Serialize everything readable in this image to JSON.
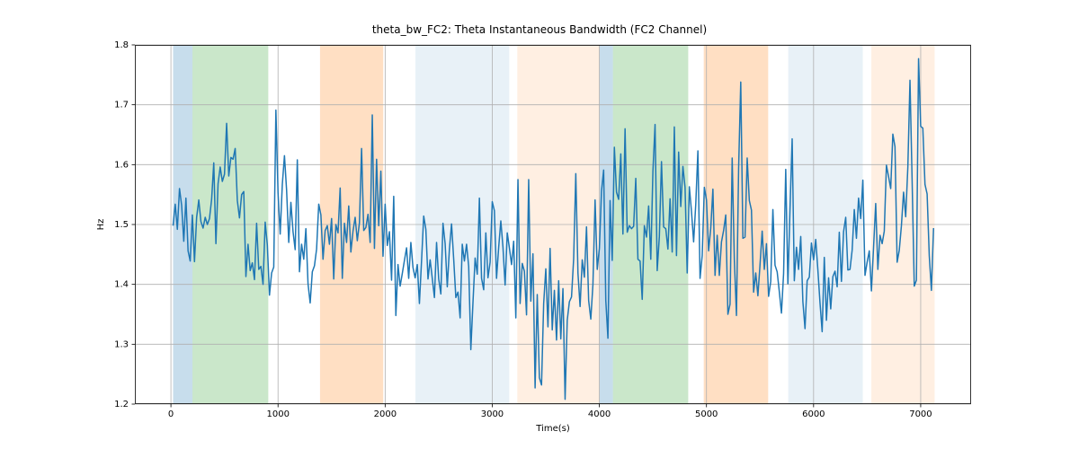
{
  "chart_data": {
    "type": "line",
    "title": "theta_bw_FC2: Theta Instantaneous Bandwidth (FC2 Channel)",
    "xlabel": "Time(s)",
    "ylabel": "Hz",
    "xlim": [
      -336.6,
      7470.6
    ],
    "ylim": [
      1.2,
      1.8
    ],
    "xticks": [
      0,
      1000,
      2000,
      3000,
      4000,
      5000,
      6000,
      7000
    ],
    "yticks": [
      1.2,
      1.3,
      1.4,
      1.5,
      1.6,
      1.7,
      1.8
    ],
    "line_color": "#1f77b4",
    "series": [
      {
        "name": "theta_bw_FC2",
        "x_start": 20,
        "x_step": 20,
        "values": [
          1.498,
          1.534,
          1.492,
          1.56,
          1.532,
          1.472,
          1.544,
          1.456,
          1.439,
          1.516,
          1.438,
          1.512,
          1.541,
          1.505,
          1.494,
          1.512,
          1.5,
          1.51,
          1.542,
          1.603,
          1.468,
          1.568,
          1.596,
          1.572,
          1.584,
          1.669,
          1.581,
          1.612,
          1.609,
          1.627,
          1.54,
          1.511,
          1.55,
          1.555,
          1.413,
          1.467,
          1.423,
          1.436,
          1.408,
          1.502,
          1.425,
          1.43,
          1.4,
          1.504,
          1.466,
          1.382,
          1.419,
          1.429,
          1.691,
          1.553,
          1.484,
          1.567,
          1.615,
          1.557,
          1.47,
          1.537,
          1.488,
          1.458,
          1.608,
          1.421,
          1.467,
          1.442,
          1.493,
          1.401,
          1.369,
          1.421,
          1.431,
          1.459,
          1.534,
          1.516,
          1.442,
          1.49,
          1.498,
          1.467,
          1.51,
          1.409,
          1.5,
          1.486,
          1.561,
          1.41,
          1.502,
          1.47,
          1.531,
          1.454,
          1.489,
          1.512,
          1.473,
          1.503,
          1.627,
          1.49,
          1.495,
          1.517,
          1.47,
          1.683,
          1.46,
          1.609,
          1.498,
          1.589,
          1.447,
          1.534,
          1.465,
          1.488,
          1.407,
          1.547,
          1.348,
          1.433,
          1.397,
          1.418,
          1.44,
          1.461,
          1.41,
          1.47,
          1.428,
          1.411,
          1.433,
          1.368,
          1.44,
          1.514,
          1.492,
          1.409,
          1.441,
          1.41,
          1.378,
          1.47,
          1.409,
          1.384,
          1.502,
          1.468,
          1.396,
          1.459,
          1.501,
          1.442,
          1.378,
          1.387,
          1.344,
          1.467,
          1.439,
          1.467,
          1.43,
          1.291,
          1.37,
          1.444,
          1.417,
          1.544,
          1.41,
          1.391,
          1.486,
          1.411,
          1.437,
          1.538,
          1.523,
          1.41,
          1.462,
          1.506,
          1.462,
          1.399,
          1.486,
          1.461,
          1.433,
          1.472,
          1.344,
          1.575,
          1.368,
          1.435,
          1.422,
          1.349,
          1.575,
          1.372,
          1.451,
          1.227,
          1.383,
          1.244,
          1.232,
          1.368,
          1.426,
          1.329,
          1.46,
          1.324,
          1.39,
          1.307,
          1.406,
          1.309,
          1.393,
          1.208,
          1.34,
          1.371,
          1.379,
          1.443,
          1.585,
          1.419,
          1.363,
          1.441,
          1.412,
          1.496,
          1.373,
          1.342,
          1.4,
          1.541,
          1.425,
          1.46,
          1.556,
          1.591,
          1.373,
          1.31,
          1.54,
          1.44,
          1.629,
          1.554,
          1.542,
          1.618,
          1.484,
          1.66,
          1.487,
          1.498,
          1.493,
          1.497,
          1.577,
          1.442,
          1.439,
          1.375,
          1.498,
          1.479,
          1.531,
          1.442,
          1.589,
          1.667,
          1.423,
          1.48,
          1.605,
          1.496,
          1.493,
          1.459,
          1.543,
          1.454,
          1.663,
          1.448,
          1.621,
          1.53,
          1.597,
          1.562,
          1.419,
          1.563,
          1.522,
          1.471,
          1.534,
          1.623,
          1.41,
          1.448,
          1.562,
          1.541,
          1.456,
          1.494,
          1.559,
          1.415,
          1.482,
          1.415,
          1.471,
          1.49,
          1.516,
          1.35,
          1.367,
          1.611,
          1.442,
          1.348,
          1.593,
          1.738,
          1.477,
          1.479,
          1.611,
          1.54,
          1.524,
          1.387,
          1.419,
          1.381,
          1.433,
          1.489,
          1.425,
          1.468,
          1.38,
          1.405,
          1.525,
          1.432,
          1.421,
          1.388,
          1.352,
          1.418,
          1.592,
          1.401,
          1.526,
          1.643,
          1.406,
          1.462,
          1.425,
          1.48,
          1.371,
          1.326,
          1.406,
          1.412,
          1.469,
          1.441,
          1.475,
          1.424,
          1.369,
          1.321,
          1.445,
          1.34,
          1.411,
          1.359,
          1.413,
          1.422,
          1.396,
          1.487,
          1.405,
          1.488,
          1.512,
          1.424,
          1.425,
          1.457,
          1.525,
          1.477,
          1.544,
          1.51,
          1.574,
          1.415,
          1.437,
          1.456,
          1.389,
          1.462,
          1.535,
          1.425,
          1.482,
          1.468,
          1.489,
          1.599,
          1.58,
          1.56,
          1.651,
          1.63,
          1.437,
          1.457,
          1.498,
          1.554,
          1.513,
          1.596,
          1.741,
          1.573,
          1.397,
          1.407,
          1.777,
          1.664,
          1.661,
          1.567,
          1.551,
          1.448,
          1.39,
          1.494
        ]
      }
    ],
    "bands": [
      {
        "start": 20,
        "end": 201.2,
        "color": "#1f77b4",
        "alpha": 0.25
      },
      {
        "start": 201.2,
        "end": 908.8,
        "color": "#2ca02c",
        "alpha": 0.25
      },
      {
        "start": 1392.0,
        "end": 1982.0,
        "color": "#ff7f0e",
        "alpha": 0.25
      },
      {
        "start": 2282.8,
        "end": 3158.6,
        "color": "#1f77b4",
        "alpha": 0.1
      },
      {
        "start": 3233.8,
        "end": 3999.0,
        "color": "#ff7f0e",
        "alpha": 0.12
      },
      {
        "start": 3999.0,
        "end": 4126.8,
        "color": "#1f77b4",
        "alpha": 0.25
      },
      {
        "start": 4126.8,
        "end": 4829.6,
        "color": "#2ca02c",
        "alpha": 0.25
      },
      {
        "start": 4974.6,
        "end": 5576.0,
        "color": "#ff7f0e",
        "alpha": 0.25
      },
      {
        "start": 5763.0,
        "end": 6459.4,
        "color": "#1f77b4",
        "alpha": 0.1
      },
      {
        "start": 6539.4,
        "end": 7130.0,
        "color": "#ff7f0e",
        "alpha": 0.12
      }
    ]
  }
}
